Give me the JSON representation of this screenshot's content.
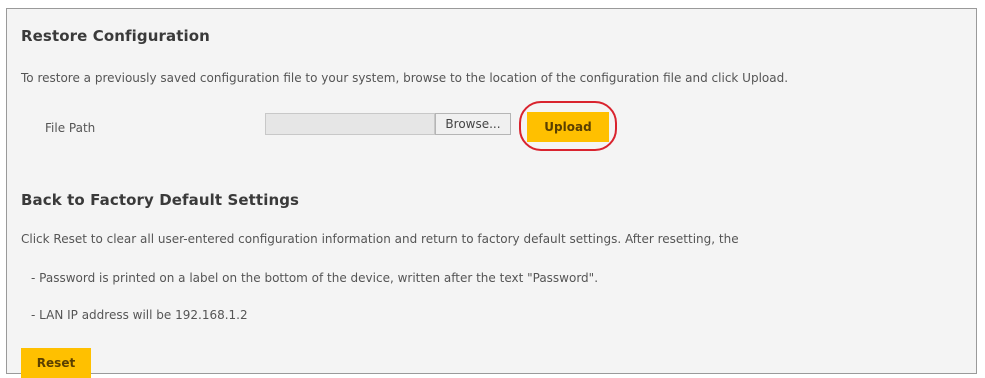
{
  "restore": {
    "title": "Restore Configuration",
    "description": "To restore a previously saved configuration file to your system, browse to the location of the configuration file and click Upload.",
    "file_path_label": "File Path",
    "file_path_value": "",
    "browse_label": "Browse...",
    "upload_label": "Upload"
  },
  "factory": {
    "title": "Back to Factory Default Settings",
    "description": "Click Reset to clear all user-entered configuration information and return to factory default settings. After resetting, the",
    "bullet_password": "- Password is printed on a label on the bottom of the device, written after the text \"Password\".",
    "bullet_lan_ip": "- LAN IP address will be 192.168.1.2",
    "reset_label": "Reset"
  },
  "colors": {
    "accent_button": "#ffc000",
    "highlight_ring": "#d9232e"
  }
}
